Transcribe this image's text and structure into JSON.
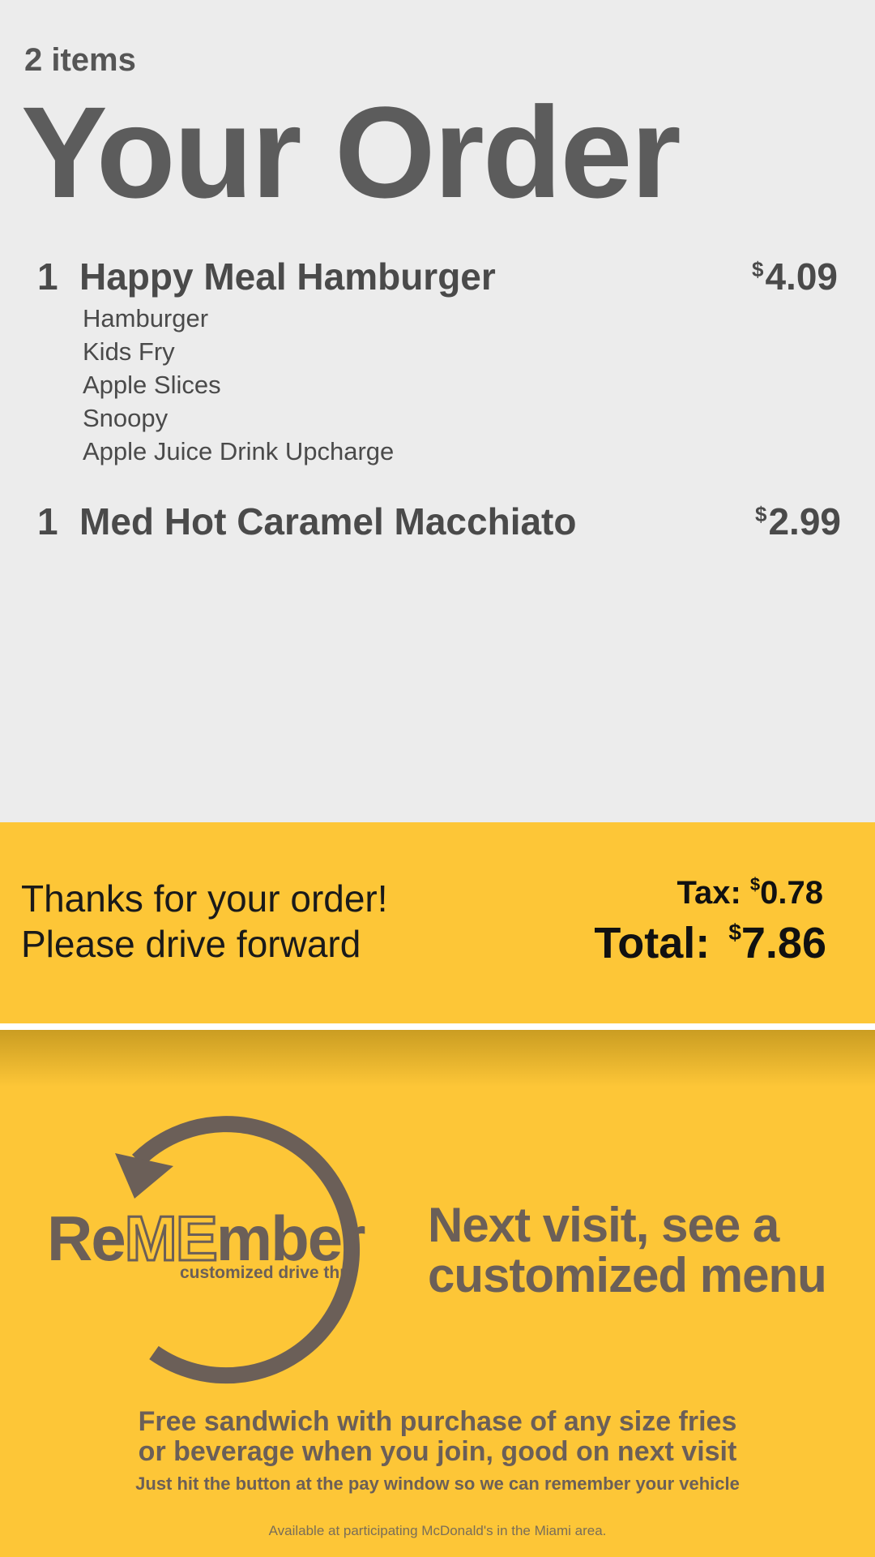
{
  "order": {
    "item_count": "2 items",
    "title": "Your Order",
    "items": [
      {
        "qty": "1",
        "name": "Happy Meal Hamburger",
        "currency": "$",
        "price": "4.09",
        "components": [
          "Hamburger",
          "Kids Fry",
          "Apple Slices",
          "Snoopy",
          "Apple Juice Drink Upcharge"
        ]
      },
      {
        "qty": "1",
        "name": "Med Hot Caramel Macchiato",
        "currency": "$",
        "price": "2.99",
        "components": []
      }
    ]
  },
  "summary": {
    "thanks_line1": "Thanks for your order!",
    "thanks_line2": "Please drive forward",
    "tax_label": "Tax:",
    "tax_currency": "$",
    "tax_value": "0.78",
    "total_label": "Total:",
    "total_currency": "$",
    "total_value": "7.86"
  },
  "promo": {
    "logo_prefix": "Re",
    "logo_me": "ME",
    "logo_suffix": "mber",
    "logo_subtitle": "customized drive thru",
    "headline_line1": "Next visit, see a",
    "headline_line2": "customized menu",
    "offer_line1": "Free sandwich with purchase of any size fries",
    "offer_line2": "or beverage when you join, good on next visit",
    "offer_note": "Just hit the button at the pay window so we can remember your vehicle",
    "availability": "Available at participating McDonald's in the Miami area."
  },
  "colors": {
    "background": "#ececec",
    "accent_yellow": "#fdc637",
    "brand_brown": "#6b5f58",
    "text_dark": "#4a4a4a"
  }
}
